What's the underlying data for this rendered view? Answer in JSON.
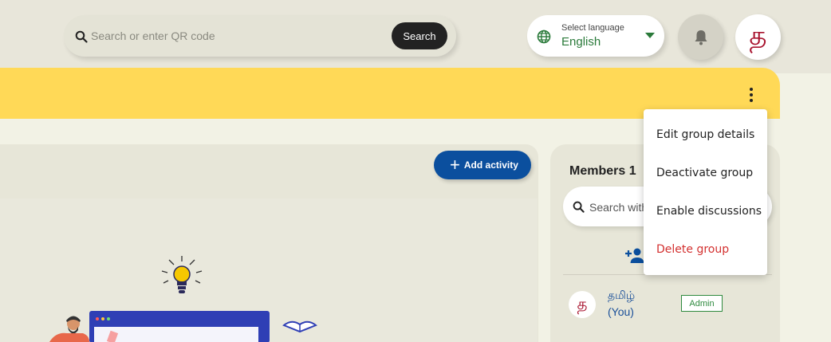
{
  "search": {
    "placeholder": "Search or enter QR code",
    "button_label": "Search"
  },
  "language": {
    "caption": "Select language",
    "value": "English"
  },
  "profile": {
    "avatar_letter": "த"
  },
  "actions": {
    "add_activity_label": "Add activity"
  },
  "members": {
    "title": "Members 1",
    "search_placeholder": "Search with name",
    "list": [
      {
        "avatar_letter": "த",
        "name": "தமிழ்",
        "you": "(You)",
        "role": "Admin"
      }
    ]
  },
  "menu": {
    "items": [
      {
        "label": "Edit group details"
      },
      {
        "label": "Deactivate group"
      },
      {
        "label": "Enable discussions"
      },
      {
        "label": "Delete group"
      }
    ]
  },
  "colors": {
    "banner": "#ffd957",
    "primary": "#0b4f9e",
    "language_green": "#2a7a3a",
    "danger": "#d3302f",
    "avatar_text": "#a8132e"
  },
  "icons": [
    "search-icon",
    "globe-icon",
    "chevron-down-icon",
    "bell-icon",
    "more-vert-icon",
    "plus-icon",
    "add-person-icon"
  ]
}
